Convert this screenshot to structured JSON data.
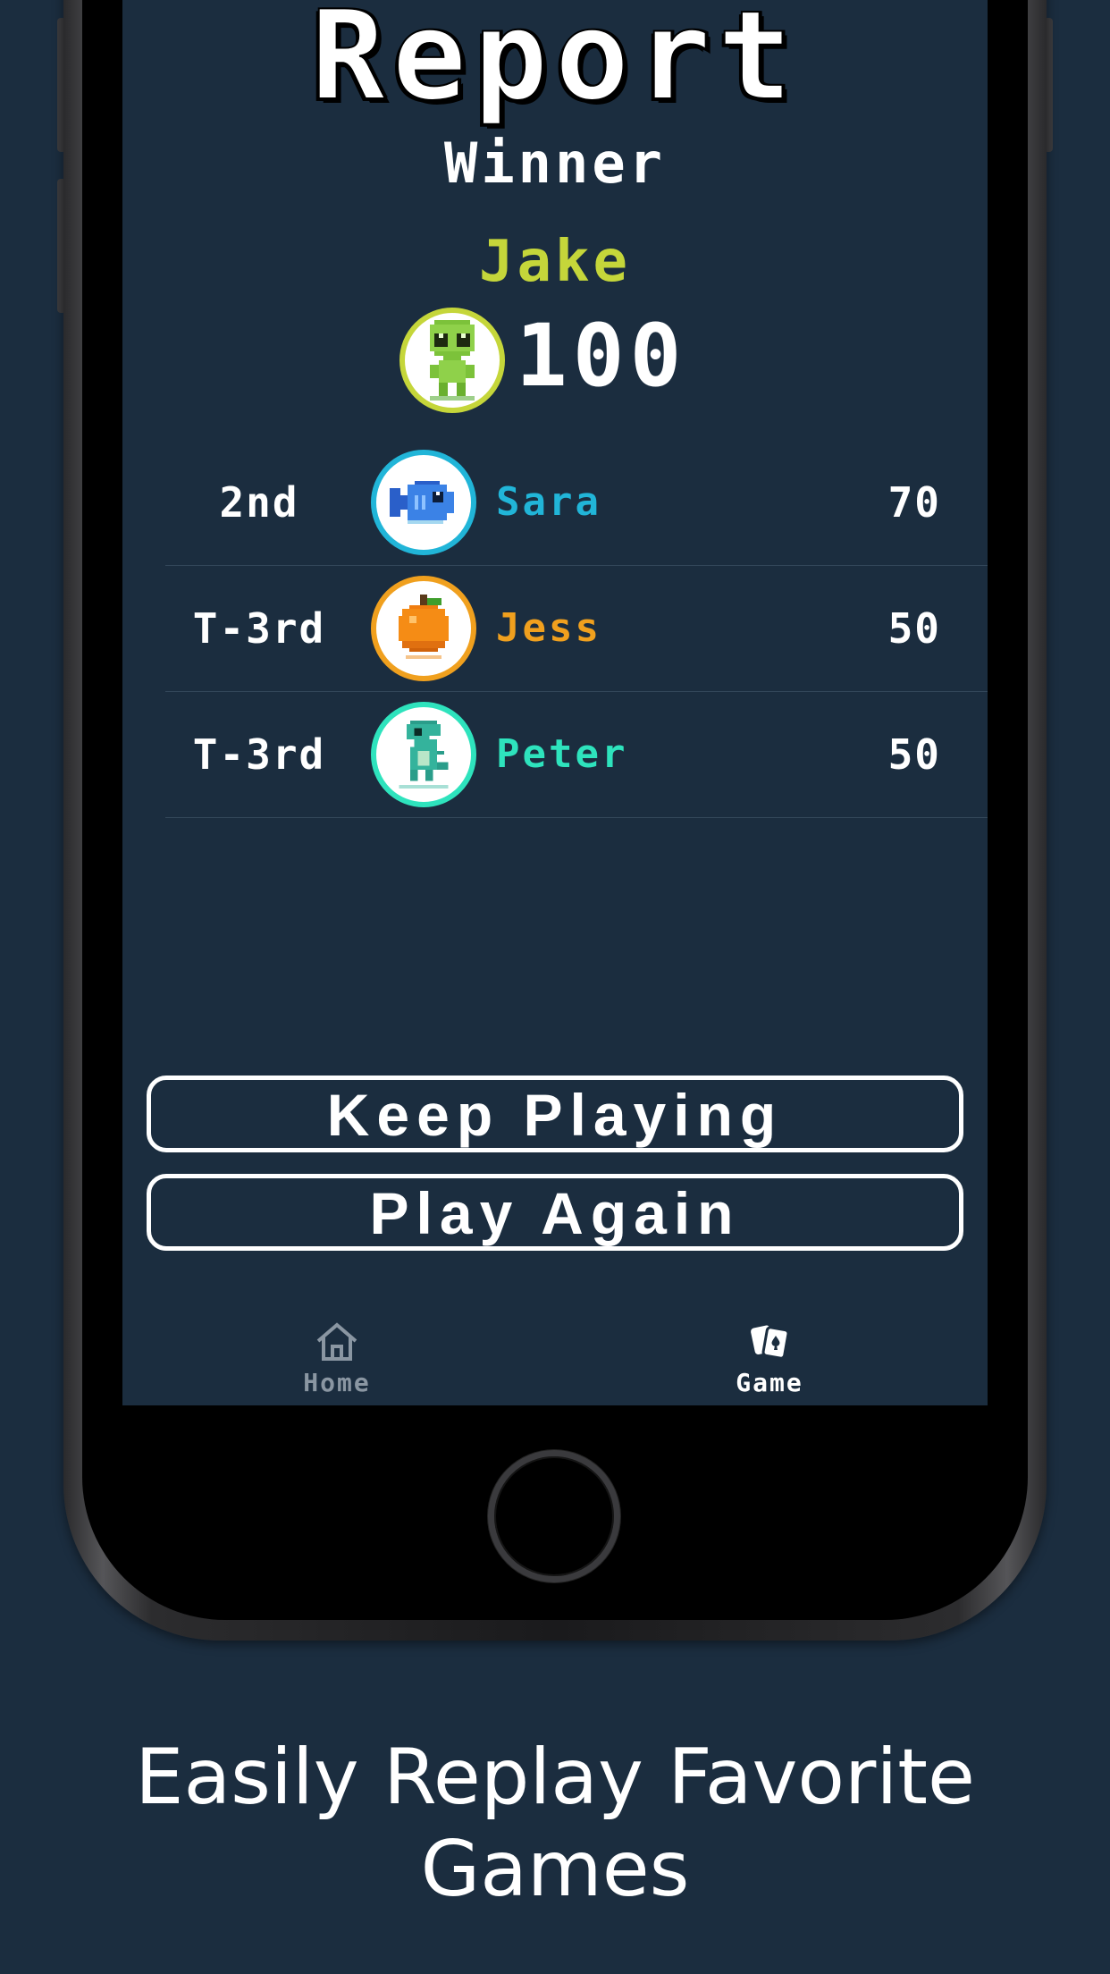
{
  "screen": {
    "title": "Report",
    "winner_label": "Winner",
    "winner": {
      "name": "Jake",
      "score": "100",
      "avatar_icon": "alien-avatar-icon",
      "color": "#c5d63a"
    },
    "rankings": [
      {
        "place": "2nd",
        "name": "Sara",
        "score": "70",
        "avatar_icon": "fish-avatar-icon",
        "color": "#21b5d8"
      },
      {
        "place": "T-3rd",
        "name": "Jess",
        "score": "50",
        "avatar_icon": "orange-avatar-icon",
        "color": "#f0a01e"
      },
      {
        "place": "T-3rd",
        "name": "Peter",
        "score": "50",
        "avatar_icon": "dinosaur-avatar-icon",
        "color": "#2ee3bd"
      }
    ],
    "buttons": {
      "keep_playing": "Keep Playing",
      "play_again": "Play Again"
    },
    "tabbar": [
      {
        "label": "Home",
        "icon": "home-icon",
        "active": false
      },
      {
        "label": "Game",
        "icon": "cards-icon",
        "active": true
      }
    ]
  },
  "caption": {
    "line1": "Easily Replay Favorite",
    "line2": "Games"
  },
  "colors": {
    "background": "#1b2d3f",
    "text": "#ffffff",
    "inactive_tab": "#8a96a2"
  }
}
